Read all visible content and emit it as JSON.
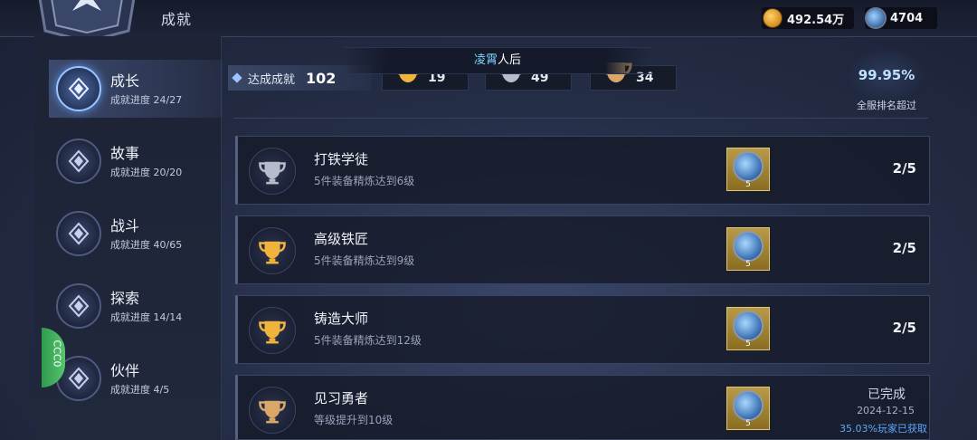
{
  "header": {
    "title": "成就",
    "gold": "492.54万",
    "gems": "4704"
  },
  "sidebar": {
    "items": [
      {
        "label": "成长",
        "progress": "成就进度 24/27",
        "active": true
      },
      {
        "label": "故事",
        "progress": "成就进度 20/20",
        "active": false
      },
      {
        "label": "战斗",
        "progress": "成就进度 40/65",
        "active": false
      },
      {
        "label": "探索",
        "progress": "成就进度 14/14",
        "active": false
      },
      {
        "label": "伙伴",
        "progress": "成就进度 4/5",
        "active": false
      }
    ],
    "green_tab": "CCC0"
  },
  "summary": {
    "label": "达成成就",
    "value": "102",
    "trophy_counts": [
      {
        "tier": "gold",
        "count": "19"
      },
      {
        "tier": "silver",
        "count": "49"
      },
      {
        "tier": "bronze",
        "count": "34"
      }
    ],
    "banner_name": "凌霄",
    "banner_text": "人后",
    "rank_percent": "99.95%",
    "rank_label": "全服排名超过"
  },
  "achievements": [
    {
      "title": "打铁学徒",
      "desc": "5件装备精炼达到6级",
      "reward_qty": "5",
      "progress": "2/5",
      "tier": "silver"
    },
    {
      "title": "高级铁匠",
      "desc": "5件装备精炼达到9级",
      "reward_qty": "5",
      "progress": "2/5",
      "tier": "gold"
    },
    {
      "title": "铸造大师",
      "desc": "5件装备精炼达到12级",
      "reward_qty": "5",
      "progress": "2/5",
      "tier": "gold"
    },
    {
      "title": "见习勇者",
      "desc": "等级提升到10级",
      "reward_qty": "5",
      "status": "已完成",
      "date": "2024-12-15",
      "percent_text": "35.03%玩家已获取",
      "tier": "bronze"
    }
  ],
  "colors": {
    "accent": "#9cc4ff",
    "gold_trophy": "#f0b43c",
    "silver_trophy": "#b6bccb",
    "bronze_trophy": "#d9a868",
    "highlight_blue": "#5ba8ff"
  }
}
